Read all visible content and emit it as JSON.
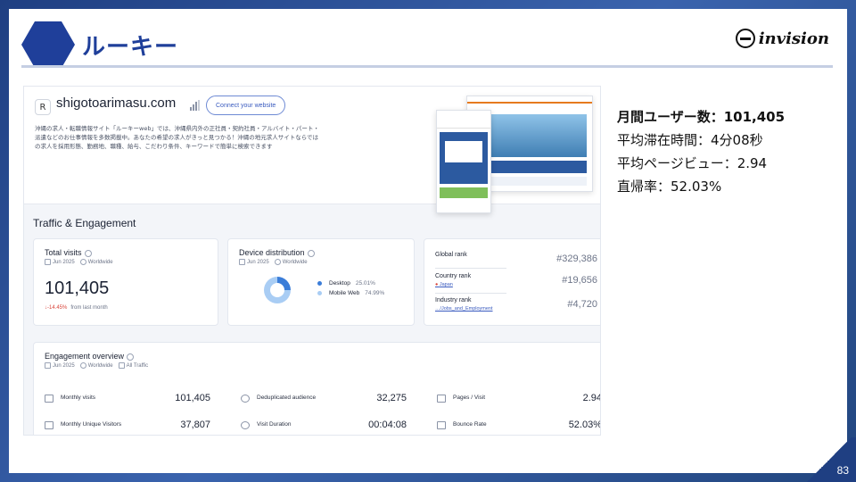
{
  "slide": {
    "title": "ルーキー",
    "logo_text": "invision",
    "page_number": "83"
  },
  "site": {
    "badge": "R",
    "domain": "shigotoarimasu.com",
    "connect_label": "Connect your website",
    "description": "沖縄の求人・転職情報サイト「ルーキーweb」では、沖縄県内外の正社員・契約社員・アルバイト・パート・派遣などのお仕事情報を多数掲載中。あなたの希望の求人がきっと見つかる！沖縄の地元求人サイトならではの求人を採用形態、勤務地、職種、給与、こだわり条件、キーワードで簡単に検索できます"
  },
  "section_title": "Traffic & Engagement",
  "total_visits": {
    "title": "Total visits",
    "period": "Jun 2025",
    "region": "Worldwide",
    "value": "101,405",
    "delta": "↓-14.45%",
    "delta_note": "from last month"
  },
  "device": {
    "title": "Device distribution",
    "period": "Jun 2025",
    "region": "Worldwide",
    "items": [
      {
        "label": "Desktop",
        "pct": "25.01%",
        "color": "#3b7dd8"
      },
      {
        "label": "Mobile Web",
        "pct": "74.99%",
        "color": "#a9cdf4"
      }
    ]
  },
  "ranks": [
    {
      "label": "Global rank",
      "sub": "",
      "value": "#329,386"
    },
    {
      "label": "Country rank",
      "sub": "Japan",
      "value": "#19,656"
    },
    {
      "label": "Industry rank",
      "sub": "…/Jobs_and_Employment",
      "value": "#4,720"
    }
  ],
  "engagement": {
    "title": "Engagement overview",
    "period": "Jun 2025",
    "region": "Worldwide",
    "traffic": "All Traffic",
    "items": [
      {
        "label": "Monthly visits",
        "value": "101,405"
      },
      {
        "label": "Deduplicated audience",
        "value": "32,275"
      },
      {
        "label": "Pages / Visit",
        "value": "2.94"
      },
      {
        "label": "Monthly Unique Visitors",
        "value": "37,807"
      },
      {
        "label": "Visit Duration",
        "value": "00:04:08"
      },
      {
        "label": "Bounce Rate",
        "value": "52.03%"
      }
    ]
  },
  "stats": {
    "line1_label": "月間ユーザー数：",
    "line1_value": "101,405",
    "line2": "平均滞在時間：4分08秒",
    "line3": "平均ページビュー：2.94",
    "line4": "直帰率：52.03%"
  }
}
